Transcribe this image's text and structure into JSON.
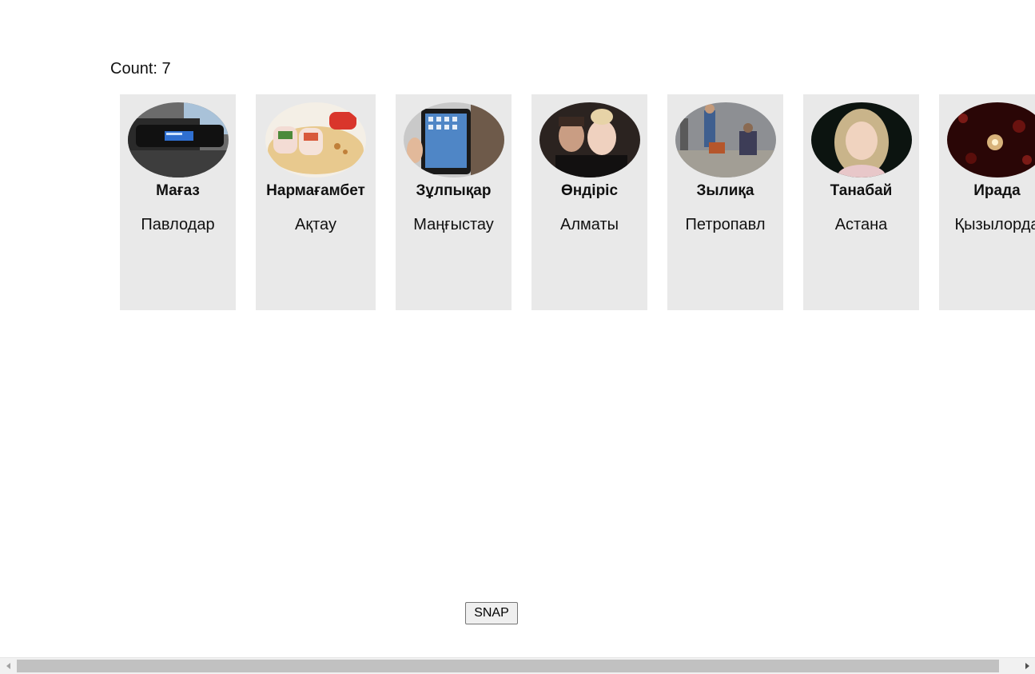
{
  "count_label": "Count: 7",
  "cards": [
    {
      "name": "Мағаз",
      "city": "Павлодар",
      "image_icon": "music-player-photo"
    },
    {
      "name": "Нармағамбет",
      "city": "Ақтау",
      "image_icon": "sushi-rolls-photo"
    },
    {
      "name": "Зұлпықар",
      "city": "Маңғыстау",
      "image_icon": "tablet-photo"
    },
    {
      "name": "Өндіріс",
      "city": "Алматы",
      "image_icon": "couple-portrait-photo"
    },
    {
      "name": "Зылиқа",
      "city": "Петропавл",
      "image_icon": "street-scene-photo"
    },
    {
      "name": "Танабай",
      "city": "Астана",
      "image_icon": "girl-portrait-photo"
    },
    {
      "name": "Ирада",
      "city": "Қызылорда",
      "image_icon": "night-lights-photo"
    }
  ],
  "snap_button": {
    "label": "SNAP"
  },
  "colors": {
    "card_background": "#e9e9e9",
    "page_background": "#ffffff",
    "scrollbar_thumb": "#c1c1c1"
  }
}
